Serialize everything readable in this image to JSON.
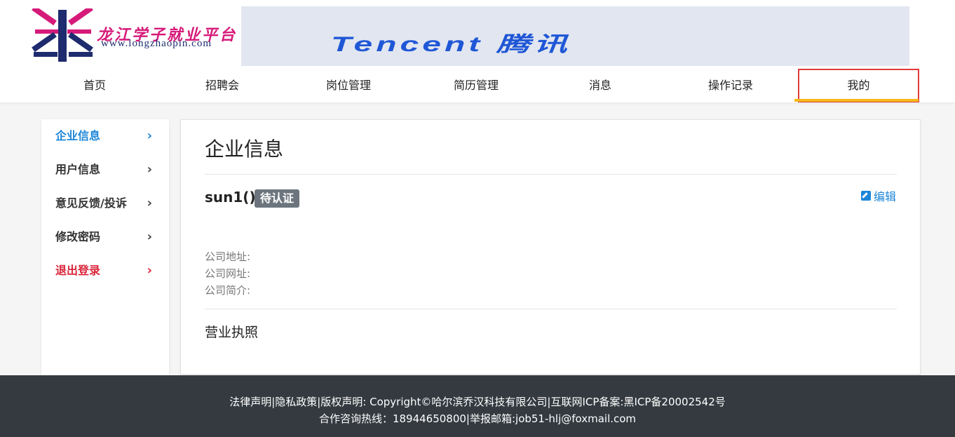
{
  "logo": {
    "title": "龙江学子就业平台",
    "url": "www.longzhaopin.com"
  },
  "banner": {
    "text": "Tencent 腾讯"
  },
  "nav": {
    "items": [
      {
        "label": "首页"
      },
      {
        "label": "招聘会"
      },
      {
        "label": "岗位管理"
      },
      {
        "label": "简历管理"
      },
      {
        "label": "消息"
      },
      {
        "label": "操作记录"
      },
      {
        "label": "我的"
      }
    ]
  },
  "sidebar": {
    "items": [
      {
        "label": "企业信息",
        "chevron": "›"
      },
      {
        "label": "用户信息",
        "chevron": "›"
      },
      {
        "label": "意见反馈/投诉",
        "chevron": "›"
      },
      {
        "label": "修改密码",
        "chevron": "›"
      },
      {
        "label": "退出登录",
        "chevron": "›"
      }
    ]
  },
  "main": {
    "title": "企业信息",
    "company_name": "sun1()",
    "status_badge": "待认证",
    "edit_label": "编辑",
    "address_label": "公司地址:",
    "website_label": "公司网址:",
    "intro_label": "公司简介:",
    "license_label": "营业执照"
  },
  "footer": {
    "line1": "法律声明|隐私政策|版权声明: Copyright©哈尔滨乔汉科技有限公司|互联网ICP备案:黑ICP备20002542号",
    "line2": "合作咨询热线：18944650800|举报邮箱:job51-hlj@foxmail.com"
  },
  "colors": {
    "accent": "#1c86d8",
    "danger": "#d9263a",
    "nav_underline": "#f6b91a",
    "footer_bg": "#343a40",
    "badge_bg": "#6c757d"
  }
}
